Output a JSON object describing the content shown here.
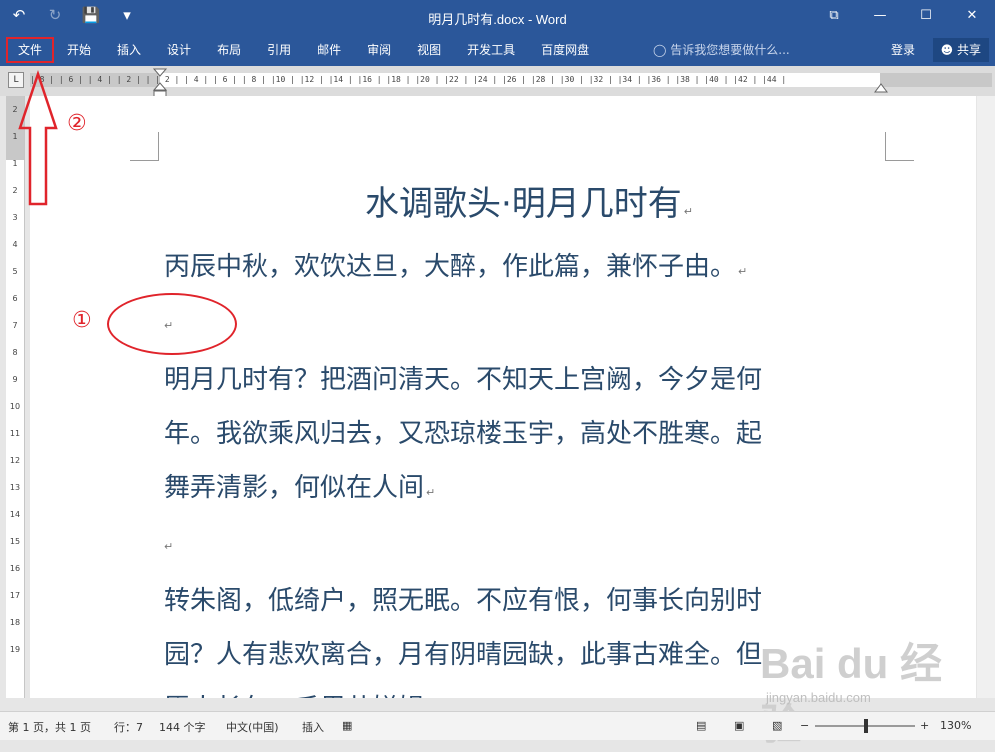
{
  "window": {
    "title": "明月几时有.docx - Word",
    "qat": {
      "undo": "↶",
      "redo": "↻",
      "save": "💾",
      "customize": "▾"
    },
    "buttons": {
      "ribbon_display": "⧉",
      "minimize": "—",
      "maximize": "☐",
      "close": "✕"
    }
  },
  "ribbon": {
    "tabs": [
      "文件",
      "开始",
      "插入",
      "设计",
      "布局",
      "引用",
      "邮件",
      "审阅",
      "视图",
      "开发工具",
      "百度网盘"
    ],
    "tell_me": "告诉我您想要做什么...",
    "login": "登录",
    "share": "共享"
  },
  "ruler": {
    "corner": "L",
    "ticks": "  | 8 |   | 6 |   | 4 |   | 2 |   |   | 2 |   | 4 |   | 6 |   | 8 |   |10 |   |12 |   |14 |   |16 |   |18 |   |20 |   |22 |   |24 |   |26 |   |28 |   |30 |   |32 |   |34 |   |36 |   |38 |   |40 |   |42 |   |44 |",
    "vticks": [
      "2",
      "1",
      "",
      "1",
      "2",
      "3",
      "4",
      "5",
      "6",
      "7",
      "8",
      "9",
      "10",
      "11",
      "12",
      "13",
      "14",
      "15",
      "16",
      "17",
      "18",
      "19"
    ]
  },
  "document": {
    "title": "水调歌头·明月几时有",
    "paragraph_mark": "↵",
    "lines": [
      "丙辰中秋，欢饮达旦，大醉，作此篇，兼怀子由。",
      "",
      "明月几时有？把酒问清天。不知天上宫阙，今夕是何",
      "年。我欲乘风归去，又恐琼楼玉宇，高处不胜寒。起",
      "舞弄清影，何似在人间",
      "",
      "转朱阁，低绮户，照无眠。不应有恨，何事长向别时",
      "园？人有悲欢离合，月有阴晴园缺，此事古难全。但",
      "愿人长久，千里共婵娟。"
    ]
  },
  "annotations": {
    "num1": "①",
    "num2": "②"
  },
  "status": {
    "page": "第 1 页，共 1 页",
    "line": "行：7",
    "words": "144 个字",
    "language": "中文(中国)",
    "mode": "插入",
    "zoom_minus": "−",
    "zoom_plus": "+",
    "zoom": "130%"
  },
  "watermark": {
    "logo": "Bai du 经验",
    "url": "jingyan.baidu.com"
  },
  "colors": {
    "brand": "#2b579a",
    "annotation": "#e0242b",
    "body_text": "#2a4a6b"
  }
}
